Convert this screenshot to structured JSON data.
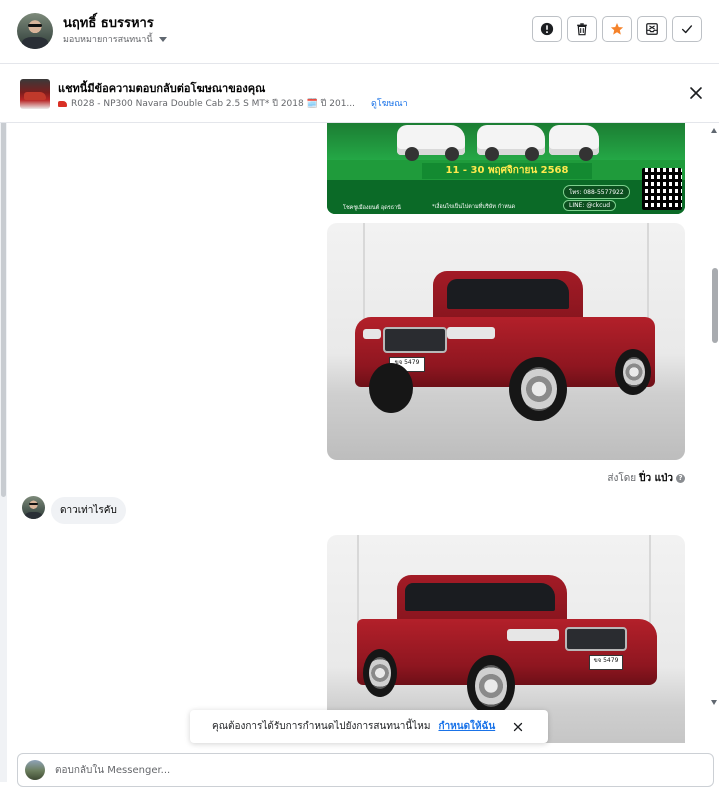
{
  "header": {
    "contact_name": "นฤทธิ์ ธบรรหาร",
    "assign_label": "มอบหมายการสนทนานี้",
    "toolbar": [
      {
        "name": "mark-spam-button",
        "icon": "exclamation-circle-icon",
        "accent": "#1c1e21"
      },
      {
        "name": "delete-button",
        "icon": "trash-icon",
        "accent": "#1c1e21"
      },
      {
        "name": "star-button",
        "icon": "star-icon",
        "accent": "#f5822a"
      },
      {
        "name": "archive-button",
        "icon": "archive-box-icon",
        "accent": "#1c1e21"
      },
      {
        "name": "mark-done-button",
        "icon": "checkmark-icon",
        "accent": "#1c1e21"
      }
    ]
  },
  "ad_context": {
    "title": "แชทนี้มีข้อความตอบกลับต่อโฆษณาของคุณ",
    "subtitle": "R028 - NP300 Navara Double Cab 2.5 S MT* ปี 2018 🗓️ ปี 201...",
    "view_ad_link": "ดูโฆษณา"
  },
  "conversation": {
    "promo_ad": {
      "date_text": "11 - 30 พฤศจิกายน 2568",
      "phone": "โทร: 088-5577922",
      "line": "LINE: @ckcud",
      "footer": "*เงื่อนไขเป็นไปตามที่บริษัท กำหนด",
      "dealer": "โชคชูเมืองยนต์ อุดรธานี"
    },
    "photo1_plate": "ขจ 5479",
    "sent_by_label": "ส่งโดย",
    "sent_by_name": "ปิ่ว แป่ว",
    "incoming_message": "ดาวเท่าไรคับ",
    "photo2_plate": "ขจ 5479"
  },
  "toast": {
    "message": "คุณต้องการได้รับการกำหนดไปยังการสนทนานี้ไหม",
    "action": "กำหนดให้ฉัน"
  },
  "composer": {
    "placeholder": "ตอบกลับใน Messenger..."
  },
  "colors": {
    "accent_orange": "#f5822a",
    "link_blue": "#1a73e8",
    "promo_green": "#1f9b3b",
    "bubble_gray": "#f0f2f5"
  }
}
